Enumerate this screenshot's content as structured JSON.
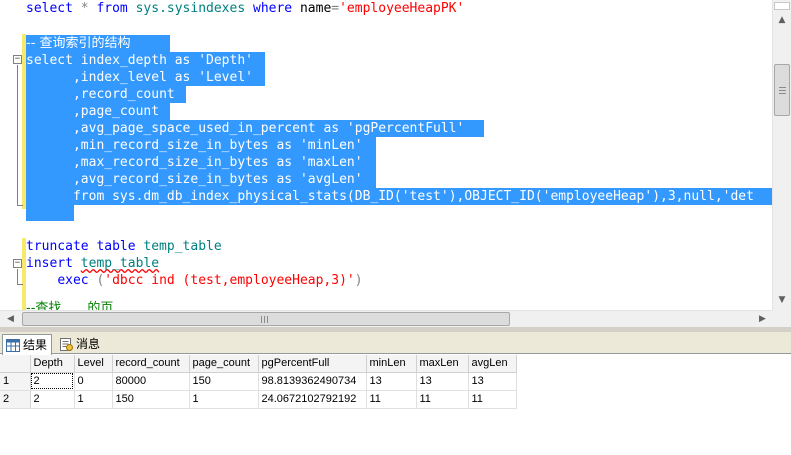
{
  "editor": {
    "line1": {
      "kw_select": "select",
      "star": "*",
      "kw_from": "from",
      "obj": "sys.sysindexes",
      "kw_where": "where",
      "col": "name",
      "eq": "=",
      "str": "'employeeHeapPK'"
    },
    "comment": "-- 查询索引的结构",
    "select_kw": "select",
    "col_index_depth": "index_depth",
    "as_kw": "as",
    "alias_depth": "'Depth'",
    "col_index_level": "index_level",
    "alias_level": "'Level'",
    "col_record_count": "record_count",
    "col_page_count": "page_count",
    "col_avg_page": "avg_page_space_used_in_percent",
    "alias_pgpercent": "'pgPercentFull'",
    "col_min": "min_record_size_in_bytes",
    "alias_min": "'minLen'",
    "col_max": "max_record_size_in_bytes",
    "alias_max": "'maxLen'",
    "col_avg": "avg_record_size_in_bytes",
    "alias_avg": "'avgLen'",
    "from_kw": "from",
    "from_obj": "sys.dm_db_index_physical_stats",
    "db_id": "DB_ID",
    "db_arg": "'test'",
    "object_id": "OBJECT_ID",
    "obj_arg": "'employeeHeap'",
    "rest": "3,null,'det",
    "truncate_kw": "truncate table",
    "temp_table": "temp_table",
    "insert_kw": "insert",
    "exec_kw": "exec",
    "exec_str": "'dbcc ind (test,employeeHeap,3)'",
    "partial_line": "--查找……的页"
  },
  "results": {
    "tabs": [
      {
        "label": "结果",
        "icon": "grid-icon"
      },
      {
        "label": "消息",
        "icon": "messages-icon"
      }
    ],
    "columns": [
      "Depth",
      "Level",
      "record_count",
      "page_count",
      "pgPercentFull",
      "minLen",
      "maxLen",
      "avgLen"
    ],
    "rows": [
      {
        "num": "1",
        "cells": [
          "2",
          "0",
          "80000",
          "150",
          "98.8139362490734",
          "13",
          "13",
          "13"
        ]
      },
      {
        "num": "2",
        "cells": [
          "2",
          "1",
          "150",
          "1",
          "24.0672102792192",
          "11",
          "11",
          "11"
        ]
      }
    ]
  },
  "colors": {
    "selection": "#3399ff",
    "keyword": "#0000ff",
    "string": "#ff0000",
    "object": "#008080",
    "function": "#ff00ff"
  }
}
